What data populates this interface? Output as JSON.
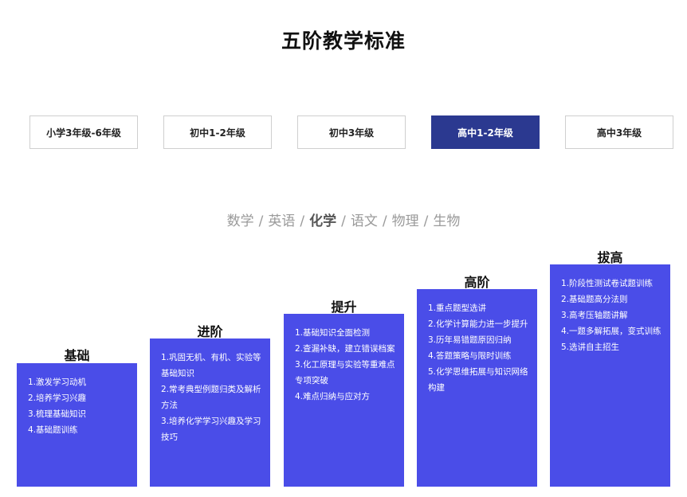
{
  "title": "五阶教学标准",
  "grade_tabs": [
    {
      "label": "小学3年级-6年级",
      "active": false
    },
    {
      "label": "初中1-2年级",
      "active": false
    },
    {
      "label": "初中3年级",
      "active": false
    },
    {
      "label": "高中1-2年级",
      "active": true
    },
    {
      "label": "高中3年级",
      "active": false
    }
  ],
  "subjects": {
    "separator": "/",
    "items": [
      {
        "label": "数学",
        "active": false
      },
      {
        "label": "英语",
        "active": false
      },
      {
        "label": "化学",
        "active": true
      },
      {
        "label": "语文",
        "active": false
      },
      {
        "label": "物理",
        "active": false
      },
      {
        "label": "生物",
        "active": false
      }
    ]
  },
  "colors": {
    "accent_tab": "#2b3990",
    "stage_box": "#4a4de8"
  },
  "stages": [
    {
      "label": "基础",
      "items": [
        "1.激发学习动机",
        "2.培养学习兴趣",
        "3.梳理基础知识",
        "4.基础题训练"
      ]
    },
    {
      "label": "进阶",
      "items": [
        "1.巩固无机、有机、实验等基础知识",
        "2.常考典型例题归类及解析方法",
        "3.培养化学学习兴趣及学习技巧"
      ]
    },
    {
      "label": "提升",
      "items": [
        "1.基础知识全面检测",
        "2.查漏补缺，建立错误档案",
        "3.化工原理与实验等重难点专项突破",
        "4.难点归纳与应对方"
      ]
    },
    {
      "label": "高阶",
      "items": [
        "1.重点题型选讲",
        "2.化学计算能力进一步提升",
        "3.历年易错题原因归纳",
        "4.答题策略与限时训练",
        "5.化学思维拓展与知识网络构建"
      ]
    },
    {
      "label": "拔高",
      "items": [
        "1.阶段性测试卷试题训练",
        "2.基础题高分法则",
        "3.高考压轴题讲解",
        "4.一题多解拓展，变式训练",
        "5.选讲自主招生"
      ]
    }
  ]
}
